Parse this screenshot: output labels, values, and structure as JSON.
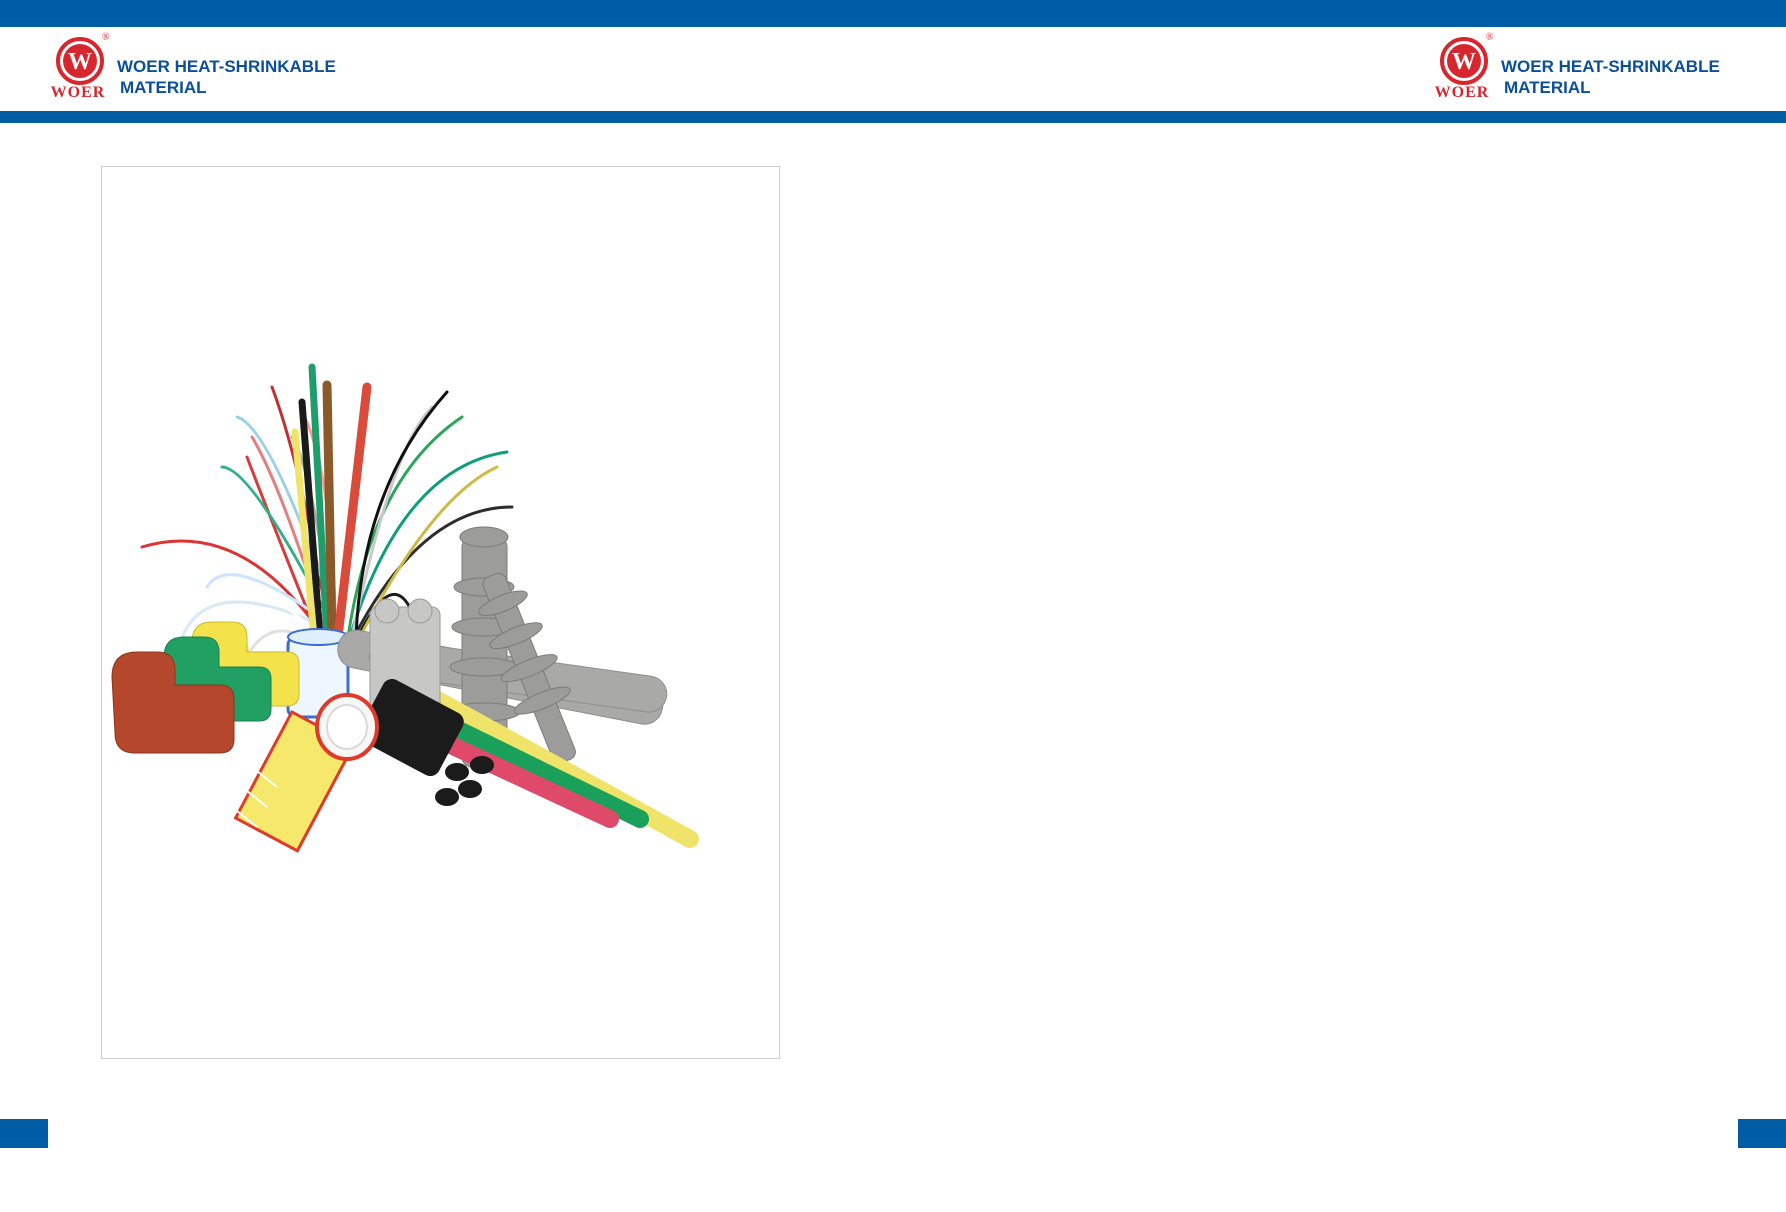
{
  "brand": {
    "logo_text": "WOER",
    "registered_mark": "®",
    "title_line1": "WOER HEAT-SHRINKABLE",
    "title_line2": "MATERIAL"
  },
  "colors": {
    "brand_blue": "#005ca4",
    "title_blue": "#0b4f9a",
    "logo_red": "#d8262e"
  },
  "photo": {
    "subject": "heat-shrinkable tubing products"
  }
}
